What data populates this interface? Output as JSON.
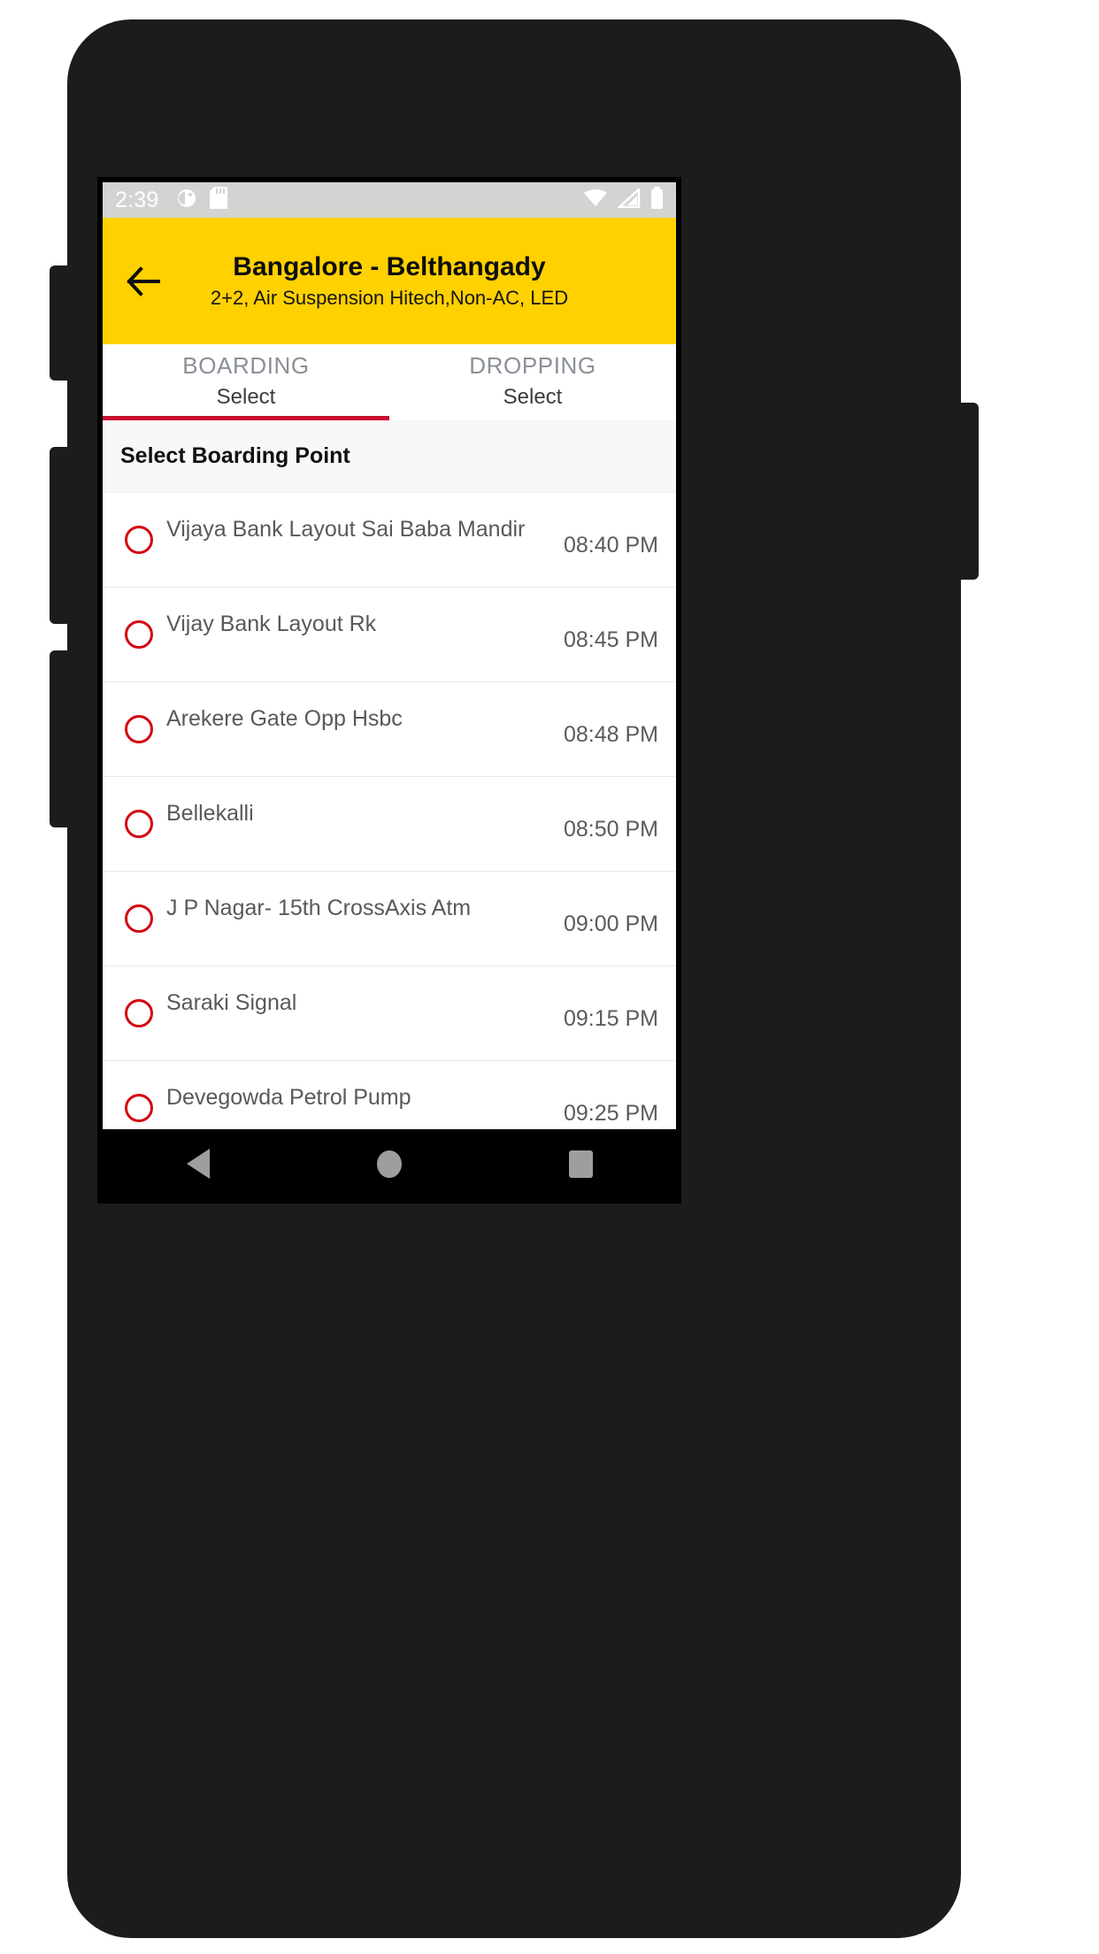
{
  "status_bar": {
    "time": "2:39",
    "left_icons": [
      "app-notification-icon",
      "sd-card-icon"
    ],
    "right_icons": [
      "wifi-icon",
      "cellular-signal-icon",
      "battery-icon"
    ]
  },
  "app_bar": {
    "back_icon": "back-arrow-icon",
    "title": "Bangalore - Belthangady",
    "subtitle": "2+2, Air Suspension Hitech,Non-AC, LED",
    "background_color": "#ffd100"
  },
  "tabs": [
    {
      "title": "BOARDING",
      "value": "Select",
      "active": true
    },
    {
      "title": "DROPPING",
      "value": "Select",
      "active": false
    }
  ],
  "tab_indicator_color": "#c8102e",
  "section": {
    "header": "Select Boarding Point"
  },
  "boarding_points": [
    {
      "name": "Vijaya Bank Layout Sai Baba Mandir",
      "time": "08:40 PM",
      "selected": false
    },
    {
      "name": "Vijay Bank Layout Rk",
      "time": "08:45 PM",
      "selected": false
    },
    {
      "name": "Arekere Gate Opp Hsbc",
      "time": "08:48 PM",
      "selected": false
    },
    {
      "name": "Bellekalli",
      "time": "08:50 PM",
      "selected": false
    },
    {
      "name": "J P Nagar- 15th CrossAxis Atm",
      "time": "09:00 PM",
      "selected": false
    },
    {
      "name": "Saraki Signal",
      "time": "09:15 PM",
      "selected": false
    },
    {
      "name": "Devegowda Petrol Pump",
      "time": "09:25 PM",
      "selected": false
    }
  ],
  "radio_color": "#d40511",
  "nav_bar": {
    "back": "nav-back-icon",
    "home": "nav-home-icon",
    "recents": "nav-recents-icon"
  }
}
